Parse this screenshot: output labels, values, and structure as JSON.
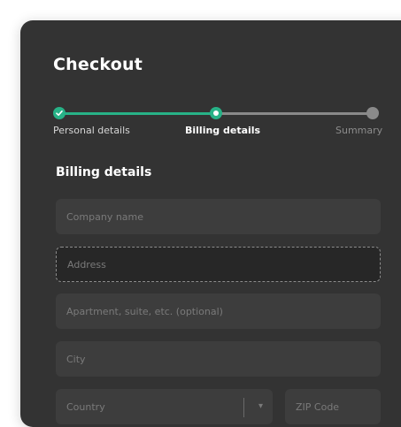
{
  "checkout": {
    "title": "Checkout",
    "steps": [
      {
        "label": "Personal details",
        "status": "complete"
      },
      {
        "label": "Billing details",
        "status": "current"
      },
      {
        "label": "Summary",
        "status": "upcoming"
      }
    ],
    "section_title": "Billing details",
    "fields": [
      {
        "placeholder": "Company name",
        "value": ""
      },
      {
        "placeholder": "Address",
        "value": "",
        "focused": true
      },
      {
        "placeholder": "Apartment, suite, etc. (optional)",
        "value": ""
      },
      {
        "placeholder": "City",
        "value": ""
      },
      {
        "placeholder": "Country",
        "value": "",
        "type": "select"
      },
      {
        "placeholder": "ZIP Code",
        "value": ""
      }
    ]
  },
  "colors": {
    "card_background": "#333333",
    "accent": "#27b287",
    "inactive_track": "#8a8a8a",
    "field_background": "#3d3d3d",
    "placeholder_text": "#7a7a7a"
  },
  "icons": {
    "step_complete": "checkmark-icon",
    "select_toggle": "chevron-down-icon"
  }
}
